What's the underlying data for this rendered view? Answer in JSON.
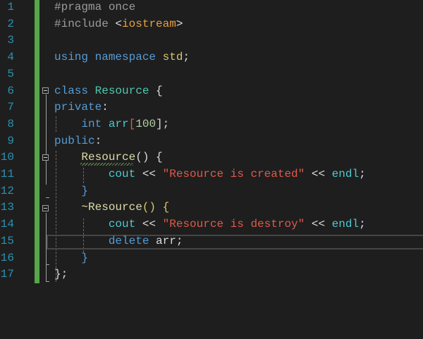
{
  "editor": {
    "colors": {
      "line_numbers": "#2b91af",
      "background": "#1e1e1e",
      "change_bar": "#57a64a"
    },
    "current_line": 15,
    "lines": [
      {
        "n": "1",
        "tokens": [
          [
            "#pragma once",
            "pre"
          ]
        ]
      },
      {
        "n": "2",
        "tokens": [
          [
            "#include ",
            "pre"
          ],
          [
            "<",
            "plain"
          ],
          [
            "iostream",
            "inc"
          ],
          [
            ">",
            "plain"
          ]
        ]
      },
      {
        "n": "3",
        "tokens": []
      },
      {
        "n": "4",
        "tokens": [
          [
            "using namespace ",
            "kw"
          ],
          [
            "std",
            "ns"
          ],
          [
            ";",
            "plain"
          ]
        ]
      },
      {
        "n": "5",
        "tokens": []
      },
      {
        "n": "6",
        "tokens": [
          [
            "class ",
            "kw"
          ],
          [
            "Resource",
            "cls"
          ],
          [
            " {",
            "plain"
          ]
        ]
      },
      {
        "n": "7",
        "tokens": [
          [
            "private",
            "kw"
          ],
          [
            ":",
            "plain"
          ]
        ]
      },
      {
        "n": "8",
        "tokens": [
          [
            "    ",
            "plain"
          ],
          [
            "int ",
            "kw"
          ],
          [
            "arr",
            "var"
          ],
          [
            "[",
            "str"
          ],
          [
            "100",
            "num"
          ],
          [
            "];",
            "plain"
          ]
        ]
      },
      {
        "n": "9",
        "tokens": [
          [
            "public",
            "kw"
          ],
          [
            ":",
            "plain"
          ]
        ]
      },
      {
        "n": "10",
        "tokens": [
          [
            "    ",
            "plain"
          ],
          [
            "Resource",
            "fn"
          ],
          [
            "() {",
            "plain"
          ]
        ]
      },
      {
        "n": "11",
        "tokens": [
          [
            "        ",
            "plain"
          ],
          [
            "cout",
            "var"
          ],
          [
            " << ",
            "plain"
          ],
          [
            "\"Resource is created\"",
            "str"
          ],
          [
            " << ",
            "plain"
          ],
          [
            "endl",
            "var"
          ],
          [
            ";",
            "plain"
          ]
        ]
      },
      {
        "n": "12",
        "tokens": [
          [
            "    ",
            "plain"
          ],
          [
            "}",
            "brace2"
          ]
        ]
      },
      {
        "n": "13",
        "tokens": [
          [
            "    ",
            "plain"
          ],
          [
            "~Resource",
            "fn"
          ],
          [
            "() {",
            "brace"
          ]
        ]
      },
      {
        "n": "14",
        "tokens": [
          [
            "        ",
            "plain"
          ],
          [
            "cout",
            "var"
          ],
          [
            " << ",
            "plain"
          ],
          [
            "\"Resource is destroy\"",
            "str"
          ],
          [
            " << ",
            "plain"
          ],
          [
            "endl",
            "var"
          ],
          [
            ";",
            "plain"
          ]
        ]
      },
      {
        "n": "15",
        "tokens": [
          [
            "        ",
            "plain"
          ],
          [
            "delete ",
            "kw"
          ],
          [
            "arr;",
            "plain"
          ]
        ]
      },
      {
        "n": "16",
        "tokens": [
          [
            "    ",
            "plain"
          ],
          [
            "}",
            "brace2"
          ]
        ]
      },
      {
        "n": "17",
        "tokens": [
          [
            "};",
            "plain"
          ]
        ]
      }
    ]
  }
}
